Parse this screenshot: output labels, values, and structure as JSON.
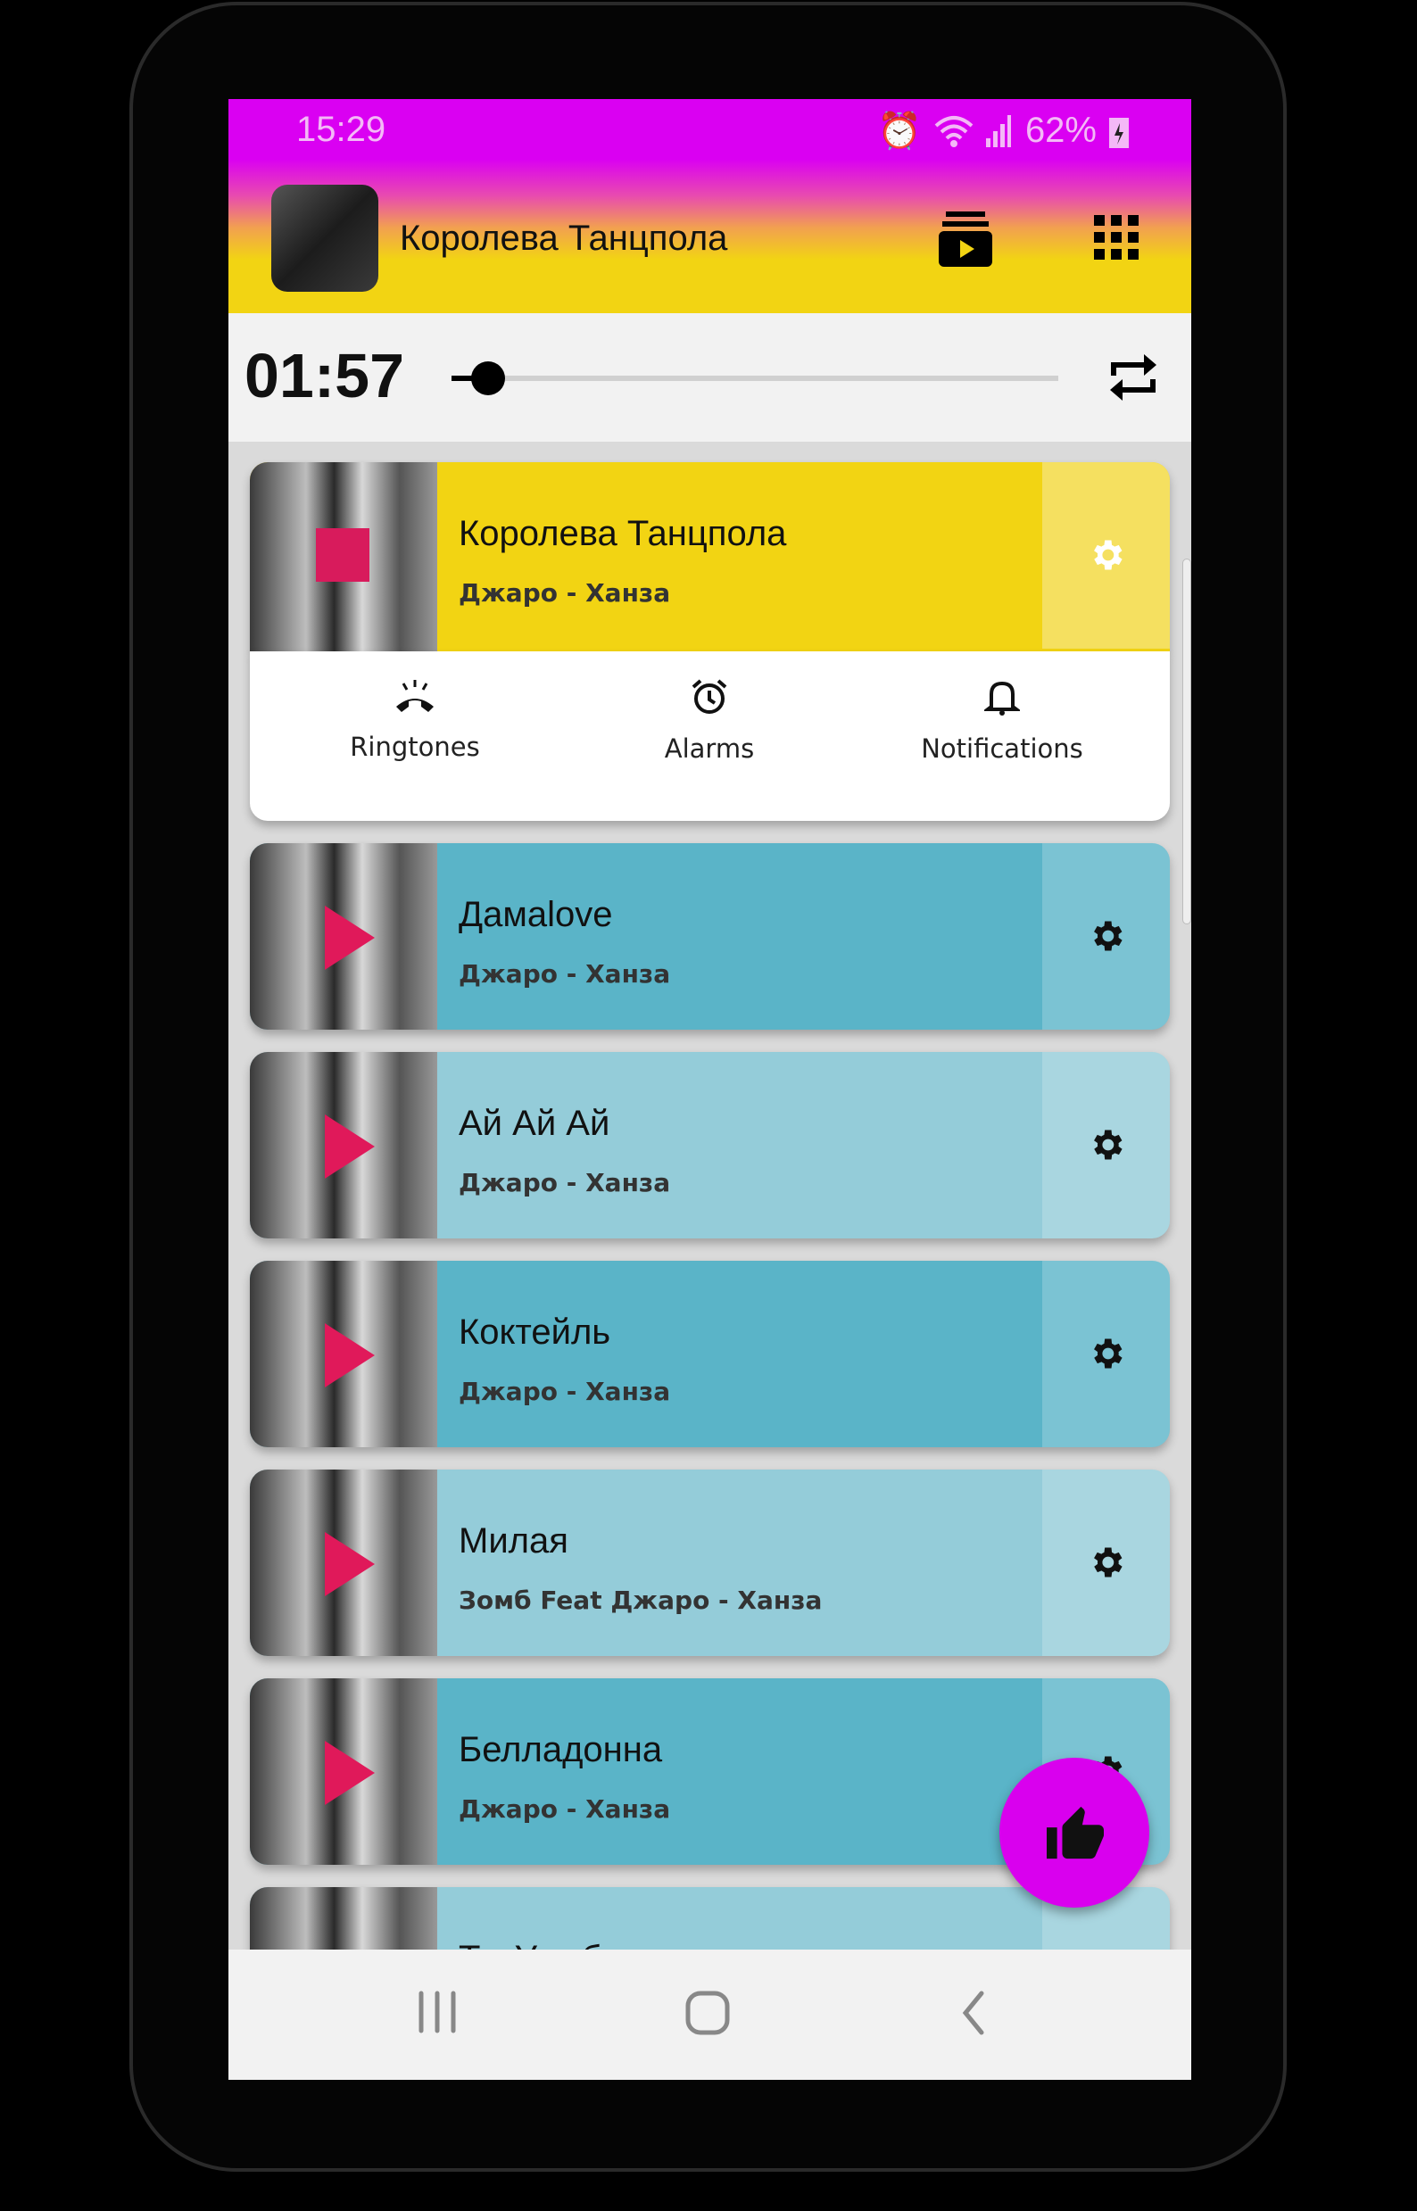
{
  "status_bar": {
    "time": "15:29",
    "battery": "62%",
    "icons": [
      "alarm-icon",
      "wifi-icon",
      "signal-icon",
      "battery-charging-icon"
    ]
  },
  "header": {
    "title": "Королева Танцпола",
    "icons": [
      "playlist-play-icon",
      "grid-menu-icon"
    ]
  },
  "player": {
    "elapsed": "01:57",
    "progress_percent": 6,
    "repeat_icon": "repeat-icon"
  },
  "colors": {
    "accent": "#da00f2",
    "header_yellow": "#f2d413",
    "teal": "#5ab4c8",
    "light_teal": "#94ccd9",
    "stop": "#d81b5c"
  },
  "current": {
    "title": "Королева Танцпола",
    "artist": "Джаро - Ханза",
    "actions": [
      {
        "label": "Ringtones",
        "icon": "phone-ringing-icon"
      },
      {
        "label": "Alarms",
        "icon": "alarm-clock-icon"
      },
      {
        "label": "Notifications",
        "icon": "bell-icon"
      }
    ]
  },
  "songs": [
    {
      "title": "Дамаlove",
      "artist": "Джаро - Ханза",
      "color": "#5ab4c8"
    },
    {
      "title": "Ай Ай Ай",
      "artist": "Джаро - Ханза",
      "color": "#94ccd9"
    },
    {
      "title": "Коктейль",
      "artist": "Джаро - Ханза",
      "color": "#5ab4c8"
    },
    {
      "title": "Милая",
      "artist": "Зомб Feat Джаро - Ханза",
      "color": "#94ccd9"
    },
    {
      "title": "Белладонна",
      "artist": "Джаро - Ханза",
      "color": "#5ab4c8"
    },
    {
      "title": "Ты Улыбаешься",
      "artist": "",
      "color": "#94ccd9"
    }
  ],
  "fab": {
    "icon": "thumbs-up-icon"
  },
  "nav": {
    "icons": [
      "recent-apps-icon",
      "home-icon",
      "back-icon"
    ]
  }
}
